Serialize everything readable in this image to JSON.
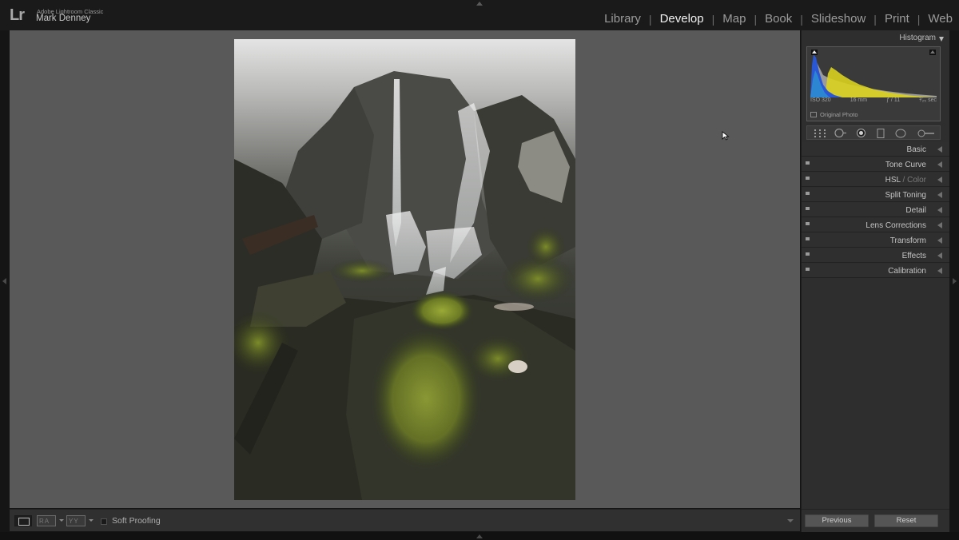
{
  "identity": {
    "logo": "Lr",
    "app_name": "Adobe Lightroom Classic",
    "user_name": "Mark Denney"
  },
  "modules": [
    {
      "label": "Library",
      "active": false
    },
    {
      "label": "Develop",
      "active": true
    },
    {
      "label": "Map",
      "active": false
    },
    {
      "label": "Book",
      "active": false
    },
    {
      "label": "Slideshow",
      "active": false
    },
    {
      "label": "Print",
      "active": false
    },
    {
      "label": "Web",
      "active": false
    }
  ],
  "module_separator": "|",
  "histogram": {
    "title": "Histogram",
    "exif": {
      "iso": "ISO 320",
      "focal_length": "16 mm",
      "aperture": "ƒ / 11",
      "shutter": "¹⁄₂₅ sec"
    },
    "original_photo_label": "Original Photo"
  },
  "tools": [
    "crop-overlay-icon",
    "spot-removal-icon",
    "red-eye-icon",
    "graduated-filter-icon",
    "radial-filter-icon",
    "adjustment-brush-icon"
  ],
  "panels": {
    "basic": "Basic",
    "tone_curve": "Tone Curve",
    "hsl": "HSL",
    "hsl_sep": " / ",
    "color": "Color",
    "split_toning": "Split Toning",
    "detail": "Detail",
    "lens_corrections": "Lens Corrections",
    "transform": "Transform",
    "effects": "Effects",
    "calibration": "Calibration"
  },
  "toolbar": {
    "view_ra": "RA",
    "view_yy": "YY",
    "soft_proofing": "Soft Proofing",
    "soft_proofing_checked": false
  },
  "buttons": {
    "previous": "Previous",
    "reset": "Reset"
  },
  "colors": {
    "work_area_bg": "#595959",
    "panel_bg": "#2e2e2e",
    "active_module": "#f2f2f2",
    "inactive_module": "#9b9b9b"
  }
}
